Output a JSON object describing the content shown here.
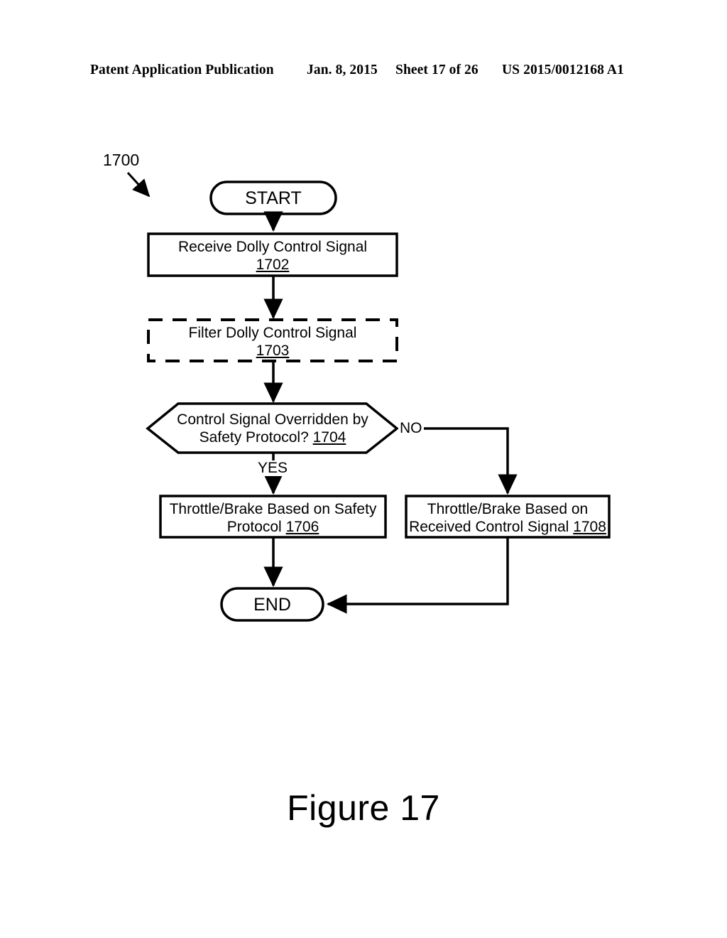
{
  "header": {
    "publication": "Patent Application Publication",
    "date": "Jan. 8, 2015",
    "sheet": "Sheet 17 of 26",
    "patent_number": "US 2015/0012168 A1"
  },
  "figure": {
    "caption": "Figure 17",
    "diagram_label": "1700",
    "colors": {
      "stroke": "#000000",
      "background": "#ffffff",
      "text": "#000000"
    },
    "nodes": [
      {
        "id": "start",
        "shape": "stadium",
        "label": "START",
        "ref": ""
      },
      {
        "id": "receive",
        "shape": "rectangle",
        "label": "Receive Dolly Control Signal",
        "ref": "1702"
      },
      {
        "id": "filter",
        "shape": "dashed-rectangle",
        "label": "Filter Dolly Control Signal",
        "ref": "1703"
      },
      {
        "id": "decision",
        "shape": "hexagon",
        "label_line1": "Control Signal Overridden by",
        "label_line2": "Safety Protocol?",
        "ref": "1704"
      },
      {
        "id": "safety",
        "shape": "rectangle",
        "label_line1": "Throttle/Brake Based on Safety",
        "label_line2": "Protocol",
        "ref": "1706"
      },
      {
        "id": "received",
        "shape": "rectangle",
        "label_line1": "Throttle/Brake Based on",
        "label_line2": "Received Control Signal",
        "ref": "1708"
      },
      {
        "id": "end",
        "shape": "stadium",
        "label": "END",
        "ref": ""
      }
    ],
    "edge_labels": {
      "yes": "YES",
      "no": "NO"
    }
  }
}
